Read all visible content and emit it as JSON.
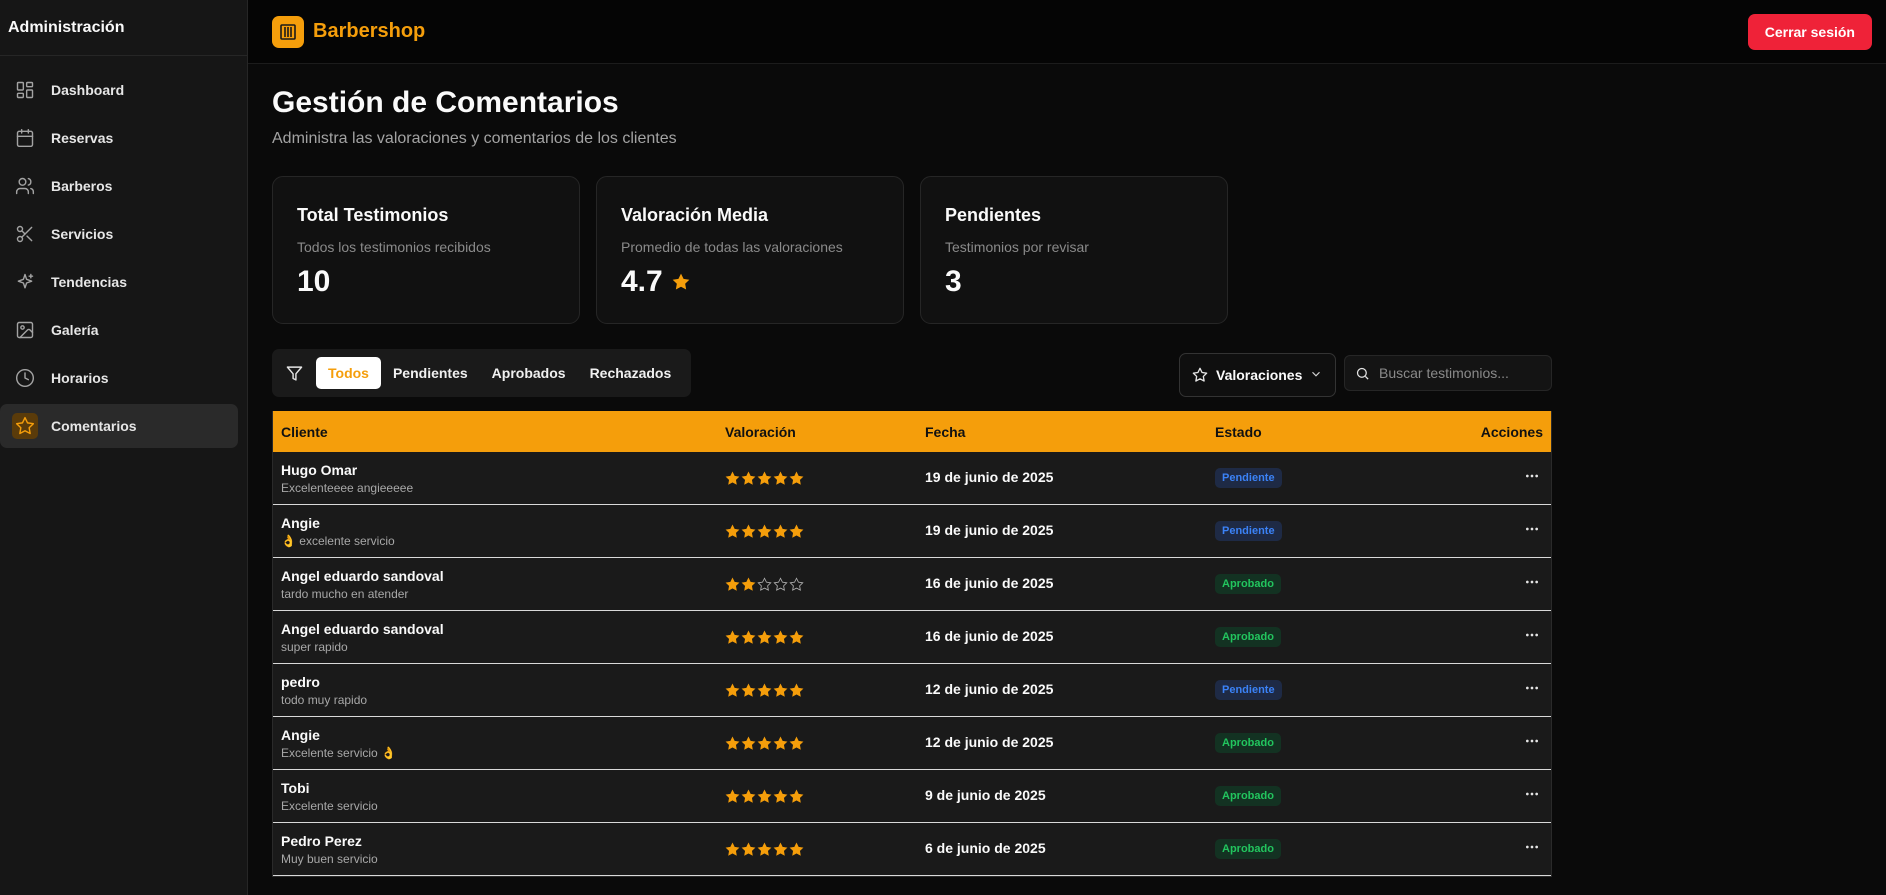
{
  "sidebar": {
    "title": "Administración",
    "items": [
      {
        "label": "Dashboard",
        "icon": "dashboard-icon"
      },
      {
        "label": "Reservas",
        "icon": "calendar-icon"
      },
      {
        "label": "Barberos",
        "icon": "users-icon"
      },
      {
        "label": "Servicios",
        "icon": "scissors-icon"
      },
      {
        "label": "Tendencias",
        "icon": "sparkles-icon"
      },
      {
        "label": "Galería",
        "icon": "image-icon"
      },
      {
        "label": "Horarios",
        "icon": "clock-icon"
      },
      {
        "label": "Comentarios",
        "icon": "star-icon",
        "active": true
      }
    ]
  },
  "header": {
    "brand": "Barbershop",
    "logout_label": "Cerrar sesión",
    "logout_color": "#ef2238",
    "accent_color": "#f59e0b"
  },
  "page": {
    "title": "Gestión de Comentarios",
    "subtitle": "Administra las valoraciones y comentarios de los clientes"
  },
  "stats": [
    {
      "title": "Total Testimonios",
      "description": "Todos los testimonios recibidos",
      "value": "10"
    },
    {
      "title": "Valoración Media",
      "description": "Promedio de todas las valoraciones",
      "value": "4.7"
    },
    {
      "title": "Pendientes",
      "description": "Testimonios por revisar",
      "value": "3"
    }
  ],
  "filters": {
    "tabs": [
      "Todos",
      "Pendientes",
      "Aprobados",
      "Rechazados"
    ],
    "active_tab": "Todos",
    "rating_select": "Valoraciones",
    "search_placeholder": "Buscar testimonios..."
  },
  "table": {
    "headers": [
      "Cliente",
      "Valoración",
      "Fecha",
      "Estado",
      "Acciones"
    ],
    "rows": [
      {
        "client": "Hugo Omar",
        "comment": "Excelenteeee angieeeee",
        "rating": 5,
        "date": "19 de junio de 2025",
        "status": "Pendiente",
        "status_type": "pending"
      },
      {
        "client": "Angie",
        "comment": "👌 excelente servicio",
        "rating": 5,
        "date": "19 de junio de 2025",
        "status": "Pendiente",
        "status_type": "pending"
      },
      {
        "client": "Angel eduardo sandoval",
        "comment": "tardo mucho en atender",
        "rating": 2,
        "date": "16 de junio de 2025",
        "status": "Aprobado",
        "status_type": "approved"
      },
      {
        "client": "Angel eduardo sandoval",
        "comment": "super rapido",
        "rating": 5,
        "date": "16 de junio de 2025",
        "status": "Aprobado",
        "status_type": "approved"
      },
      {
        "client": "pedro",
        "comment": "todo muy rapido",
        "rating": 5,
        "date": "12 de junio de 2025",
        "status": "Pendiente",
        "status_type": "pending"
      },
      {
        "client": "Angie",
        "comment": "Excelente servicio 👌",
        "rating": 5,
        "date": "12 de junio de 2025",
        "status": "Aprobado",
        "status_type": "approved"
      },
      {
        "client": "Tobi",
        "comment": "Excelente servicio",
        "rating": 5,
        "date": "9 de junio de 2025",
        "status": "Aprobado",
        "status_type": "approved"
      },
      {
        "client": "Pedro Perez",
        "comment": "Muy buen servicio",
        "rating": 5,
        "date": "6 de junio de 2025",
        "status": "Aprobado",
        "status_type": "approved"
      }
    ]
  }
}
